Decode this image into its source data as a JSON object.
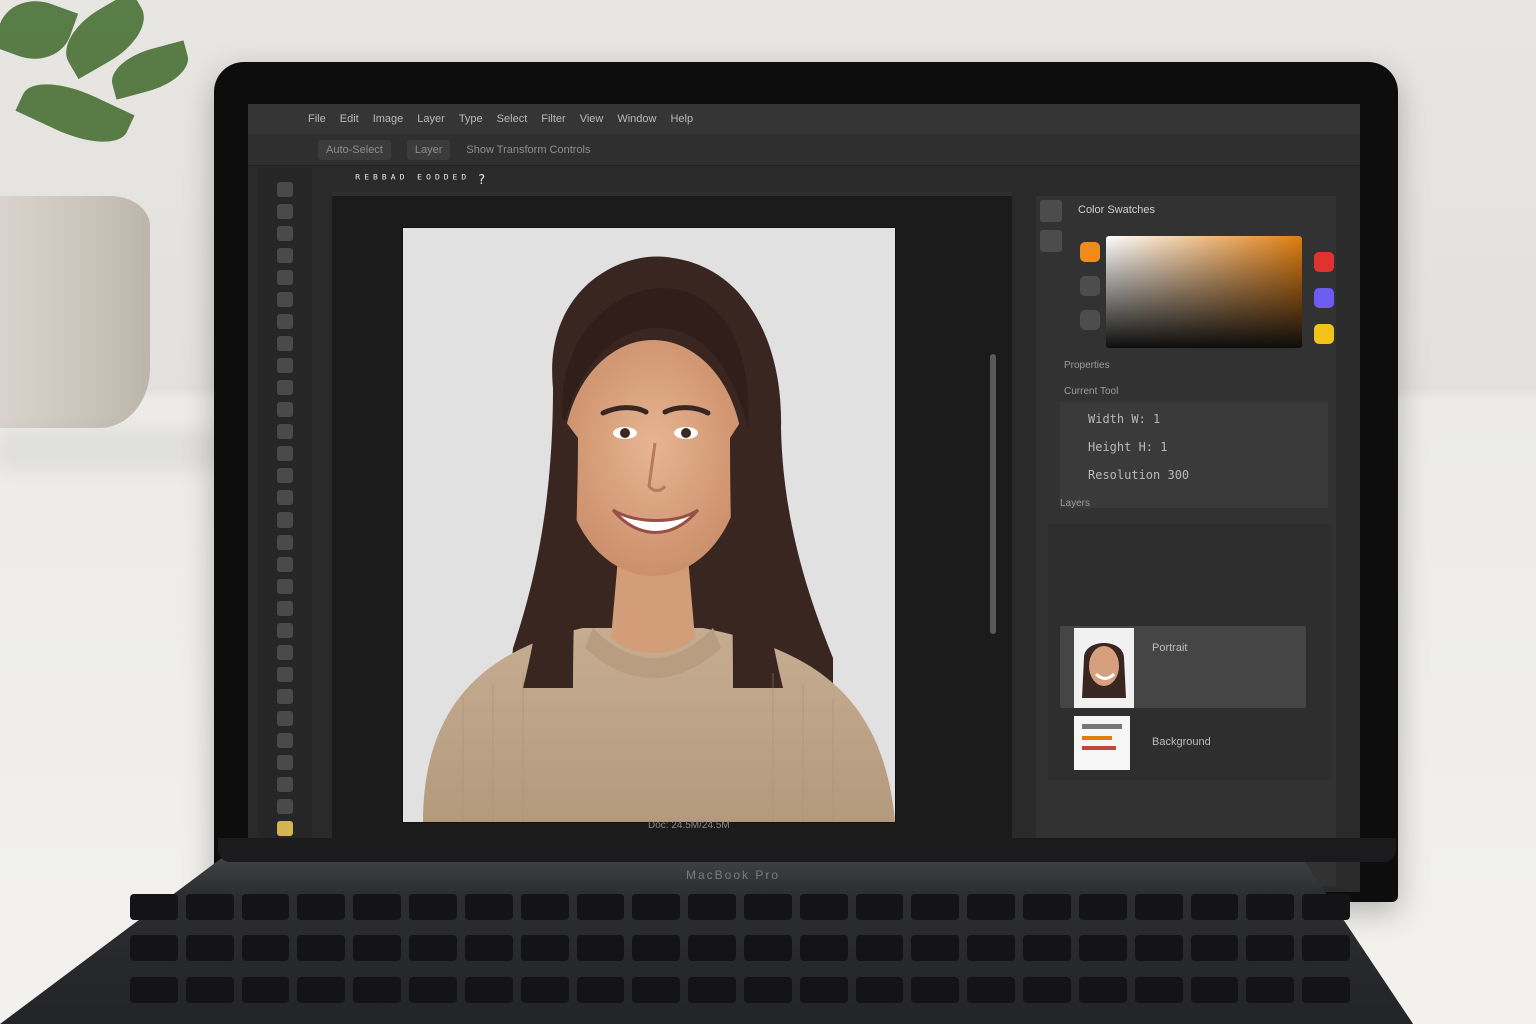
{
  "app": {
    "document_tab": "ᴿᴱᴮᴮᴬᴰ ᴱᴼᴰᴰᴱᴰ ?",
    "menu_items": [
      "File",
      "Edit",
      "Image",
      "Layer",
      "Type",
      "Select",
      "Filter",
      "View",
      "Window",
      "Help"
    ],
    "options_items": [
      "Auto-Select",
      "Layer",
      "Show Transform Controls"
    ],
    "status_text": "Doc: 24.5M/24.5M"
  },
  "panels": {
    "color_title": "Color Swatches",
    "properties_label": "Properties",
    "properties_sublabel": "Current Tool",
    "properties_rows": [
      "Width   W: 1",
      "Height  H: 1",
      "Resolution 300"
    ],
    "layers_label": "Layers",
    "layers": [
      {
        "name": "Portrait",
        "type": "photo"
      },
      {
        "name": "Background",
        "type": "doc"
      }
    ]
  },
  "laptop": {
    "brand_text": "MacBook Pro"
  },
  "colors": {
    "accent_orange": "#e07d10",
    "swatch_red": "#e0332f",
    "swatch_purple": "#6e5cf0",
    "swatch_yellow": "#f2c21b",
    "swatch_orange": "#f08b1c"
  }
}
